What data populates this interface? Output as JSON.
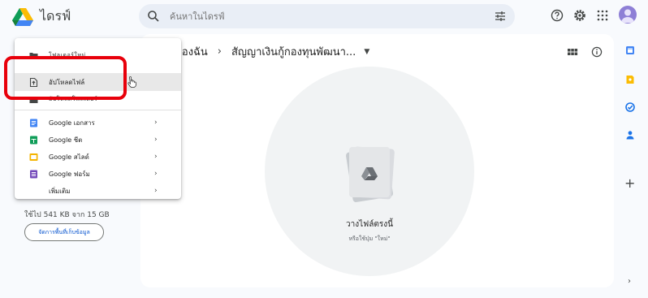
{
  "app": {
    "title": "ไดรฟ์"
  },
  "search": {
    "placeholder": "ค้นหาในไดรฟ์"
  },
  "breadcrumb": {
    "parent": "ของฉัน",
    "separator": "›",
    "current": "สัญญาเงินกู้กองทุนพัฒนา..."
  },
  "menu": {
    "items": [
      {
        "label": "โฟลเดอร์ใหม่",
        "icon": "new-folder-icon"
      },
      {
        "label": "อัปโหลดไฟล์",
        "icon": "file-upload-icon",
        "highlighted": true
      },
      {
        "label": "อัปโหลดโฟลเดอร์",
        "icon": "folder-upload-icon"
      },
      {
        "label": "Google เอกสาร",
        "icon": "google-docs-icon",
        "color": "#4285f4"
      },
      {
        "label": "Google ชีต",
        "icon": "google-sheets-icon",
        "color": "#0f9d58"
      },
      {
        "label": "Google สไลด์",
        "icon": "google-slides-icon",
        "color": "#f4b400"
      },
      {
        "label": "Google ฟอร์ม",
        "icon": "google-forms-icon",
        "color": "#7248b9"
      },
      {
        "label": "เพิ่มเติม",
        "icon": ""
      }
    ],
    "chevron": "›"
  },
  "storage": {
    "usage": "ใช้ไป 541 KB จาก 15 GB",
    "button": "จัดการพื้นที่เก็บข้อมูล"
  },
  "dropzone": {
    "title": "วางไฟล์ตรงนี้",
    "subtitle": "หรือใช้ปุ่ม \"ใหม่\""
  },
  "rail": {
    "plus": "+",
    "chevron": "›"
  },
  "annotation": {
    "color": "#e8000b"
  }
}
